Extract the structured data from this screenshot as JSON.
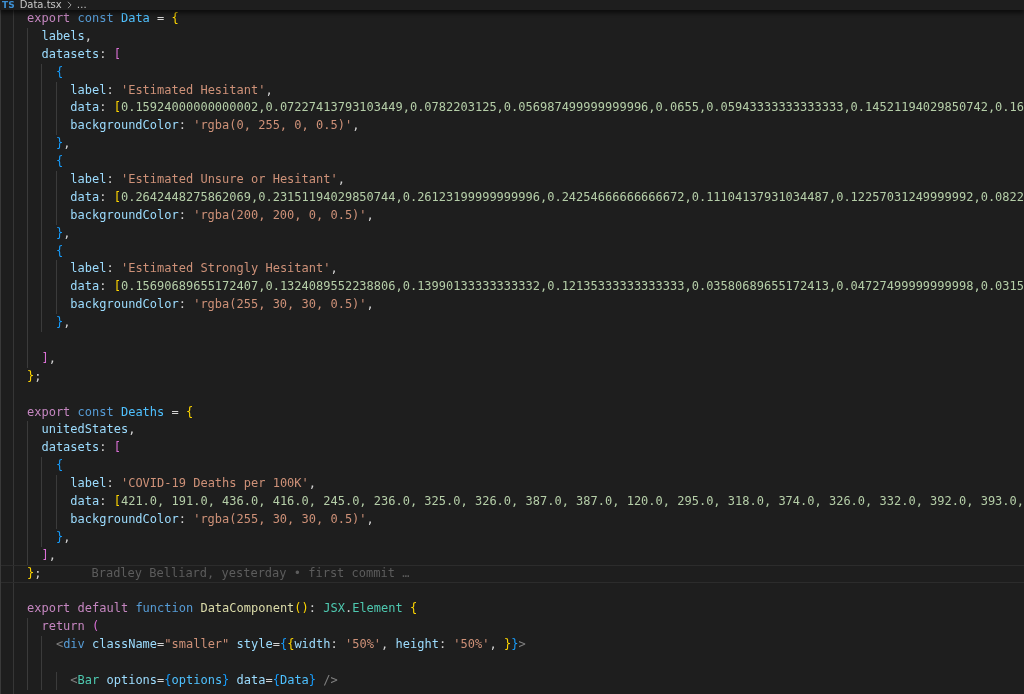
{
  "breadcrumb": {
    "file_icon": "TS",
    "items": [
      "Data.tsx",
      "…"
    ]
  },
  "editor": {
    "lines": [
      {
        "tokens": [
          {
            "kind": "keyword",
            "text": "export "
          },
          {
            "kind": "storage",
            "text": "const "
          },
          {
            "kind": "constant",
            "text": "Data"
          },
          {
            "kind": "plain",
            "text": " = "
          },
          {
            "kind": "bracket1",
            "text": "{"
          }
        ]
      },
      {
        "tokens": [
          {
            "kind": "property",
            "text": "  labels"
          },
          {
            "kind": "plain",
            "text": ","
          }
        ]
      },
      {
        "tokens": [
          {
            "kind": "property",
            "text": "  datasets"
          },
          {
            "kind": "plain",
            "text": ": "
          },
          {
            "kind": "bracket2",
            "text": "["
          }
        ]
      },
      {
        "tokens": [
          {
            "kind": "bracket3",
            "text": "    {"
          }
        ]
      },
      {
        "tokens": [
          {
            "kind": "property",
            "text": "      label"
          },
          {
            "kind": "plain",
            "text": ": "
          },
          {
            "kind": "string",
            "text": "'Estimated Hesitant'"
          },
          {
            "kind": "plain",
            "text": ","
          }
        ]
      },
      {
        "tokens": [
          {
            "kind": "property",
            "text": "      data"
          },
          {
            "kind": "plain",
            "text": ": "
          },
          {
            "kind": "bracket1",
            "text": "["
          },
          {
            "kind": "number",
            "text": "0.15924000000000002,0.07227413793103449,0.0782203125,0.056987499999999996,0.0655,0.05943333333333333,0.14521194029850742,0.16"
          }
        ]
      },
      {
        "tokens": [
          {
            "kind": "property",
            "text": "      backgroundColor"
          },
          {
            "kind": "plain",
            "text": ": "
          },
          {
            "kind": "string",
            "text": "'rgba(0, 255, 0, 0.5)'"
          },
          {
            "kind": "plain",
            "text": ","
          }
        ]
      },
      {
        "tokens": [
          {
            "kind": "bracket3",
            "text": "    }"
          },
          {
            "kind": "plain",
            "text": ","
          }
        ]
      },
      {
        "tokens": [
          {
            "kind": "bracket3",
            "text": "    {"
          }
        ]
      },
      {
        "tokens": [
          {
            "kind": "property",
            "text": "      label"
          },
          {
            "kind": "plain",
            "text": ": "
          },
          {
            "kind": "string",
            "text": "'Estimated Unsure or Hesitant'"
          },
          {
            "kind": "plain",
            "text": ","
          }
        ]
      },
      {
        "tokens": [
          {
            "kind": "property",
            "text": "      data"
          },
          {
            "kind": "plain",
            "text": ": "
          },
          {
            "kind": "bracket1",
            "text": "["
          },
          {
            "kind": "number",
            "text": "0.2642448275862069,0.23151194029850744,0.26123199999999996,0.24254666666666672,0.11104137931034487,0.12257031249999992,0.0822"
          }
        ]
      },
      {
        "tokens": [
          {
            "kind": "property",
            "text": "      backgroundColor"
          },
          {
            "kind": "plain",
            "text": ": "
          },
          {
            "kind": "string",
            "text": "'rgba(200, 200, 0, 0.5)'"
          },
          {
            "kind": "plain",
            "text": ","
          }
        ]
      },
      {
        "tokens": [
          {
            "kind": "bracket3",
            "text": "    }"
          },
          {
            "kind": "plain",
            "text": ","
          }
        ]
      },
      {
        "tokens": [
          {
            "kind": "bracket3",
            "text": "    {"
          }
        ]
      },
      {
        "tokens": [
          {
            "kind": "property",
            "text": "      label"
          },
          {
            "kind": "plain",
            "text": ": "
          },
          {
            "kind": "string",
            "text": "'Estimated Strongly Hesitant'"
          },
          {
            "kind": "plain",
            "text": ","
          }
        ]
      },
      {
        "tokens": [
          {
            "kind": "property",
            "text": "      data"
          },
          {
            "kind": "plain",
            "text": ": "
          },
          {
            "kind": "bracket1",
            "text": "["
          },
          {
            "kind": "number",
            "text": "0.15690689655172407,0.1324089552238806,0.13990133333333332,0.12135333333333333,0.03580689655172413,0.04727499999999998,0.0315"
          }
        ]
      },
      {
        "tokens": [
          {
            "kind": "property",
            "text": "      backgroundColor"
          },
          {
            "kind": "plain",
            "text": ": "
          },
          {
            "kind": "string",
            "text": "'rgba(255, 30, 30, 0.5)'"
          },
          {
            "kind": "plain",
            "text": ","
          }
        ]
      },
      {
        "tokens": [
          {
            "kind": "bracket3",
            "text": "    }"
          },
          {
            "kind": "plain",
            "text": ","
          }
        ]
      },
      {
        "kind": "blank"
      },
      {
        "tokens": [
          {
            "kind": "bracket2",
            "text": "  ]"
          },
          {
            "kind": "plain",
            "text": ","
          }
        ]
      },
      {
        "tokens": [
          {
            "kind": "bracket1",
            "text": "}"
          },
          {
            "kind": "plain",
            "text": ";"
          }
        ]
      },
      {
        "kind": "blank"
      },
      {
        "tokens": [
          {
            "kind": "keyword",
            "text": "export "
          },
          {
            "kind": "storage",
            "text": "const "
          },
          {
            "kind": "constant",
            "text": "Deaths"
          },
          {
            "kind": "plain",
            "text": " = "
          },
          {
            "kind": "bracket1",
            "text": "{"
          }
        ]
      },
      {
        "tokens": [
          {
            "kind": "property",
            "text": "  unitedStates"
          },
          {
            "kind": "plain",
            "text": ","
          }
        ]
      },
      {
        "tokens": [
          {
            "kind": "property",
            "text": "  datasets"
          },
          {
            "kind": "plain",
            "text": ": "
          },
          {
            "kind": "bracket2",
            "text": "["
          }
        ]
      },
      {
        "tokens": [
          {
            "kind": "bracket3",
            "text": "    {"
          }
        ]
      },
      {
        "tokens": [
          {
            "kind": "property",
            "text": "      label"
          },
          {
            "kind": "plain",
            "text": ": "
          },
          {
            "kind": "string",
            "text": "'COVID-19 Deaths per 100K'"
          },
          {
            "kind": "plain",
            "text": ","
          }
        ]
      },
      {
        "tokens": [
          {
            "kind": "property",
            "text": "      data"
          },
          {
            "kind": "plain",
            "text": ": "
          },
          {
            "kind": "bracket1",
            "text": "["
          },
          {
            "kind": "number",
            "text": "421.0, 191.0, 436.0, 416.0, 245.0, 236.0, 325.0, 326.0, 387.0, 387.0, 120.0, 295.0, 318.0, 374.0, 326.0, 332.0, 392.0, 393.0,"
          }
        ]
      },
      {
        "tokens": [
          {
            "kind": "property",
            "text": "      backgroundColor"
          },
          {
            "kind": "plain",
            "text": ": "
          },
          {
            "kind": "string",
            "text": "'rgba(255, 30, 30, 0.5)'"
          },
          {
            "kind": "plain",
            "text": ","
          }
        ]
      },
      {
        "tokens": [
          {
            "kind": "bracket3",
            "text": "    }"
          },
          {
            "kind": "plain",
            "text": ","
          }
        ]
      },
      {
        "tokens": [
          {
            "kind": "bracket2",
            "text": "  ]"
          },
          {
            "kind": "plain",
            "text": ","
          }
        ]
      },
      {
        "tokens": [
          {
            "kind": "bracket1",
            "text": "}"
          },
          {
            "kind": "plain",
            "text": ";"
          }
        ],
        "current": true,
        "blame": "Bradley Belliard, yesterday • first commit …"
      },
      {
        "kind": "blank"
      },
      {
        "tokens": [
          {
            "kind": "keyword",
            "text": "export default "
          },
          {
            "kind": "storage",
            "text": "function "
          },
          {
            "kind": "function",
            "text": "DataComponent"
          },
          {
            "kind": "bracket1",
            "text": "()"
          },
          {
            "kind": "plain",
            "text": ": "
          },
          {
            "kind": "type",
            "text": "JSX"
          },
          {
            "kind": "plain",
            "text": "."
          },
          {
            "kind": "type",
            "text": "Element "
          },
          {
            "kind": "bracket1",
            "text": "{"
          }
        ]
      },
      {
        "tokens": [
          {
            "kind": "keyword",
            "text": "  return "
          },
          {
            "kind": "bracket2",
            "text": "("
          }
        ]
      },
      {
        "tokens": [
          {
            "kind": "tag",
            "text": "    <"
          },
          {
            "kind": "storage",
            "text": "div "
          },
          {
            "kind": "property",
            "text": "className"
          },
          {
            "kind": "plain",
            "text": "="
          },
          {
            "kind": "string",
            "text": "\"smaller\" "
          },
          {
            "kind": "property",
            "text": "style"
          },
          {
            "kind": "plain",
            "text": "="
          },
          {
            "kind": "bracket3",
            "text": "{"
          },
          {
            "kind": "bracket1",
            "text": "{"
          },
          {
            "kind": "property",
            "text": "width"
          },
          {
            "kind": "plain",
            "text": ": "
          },
          {
            "kind": "string",
            "text": "'50%'"
          },
          {
            "kind": "plain",
            "text": ", "
          },
          {
            "kind": "property",
            "text": "height"
          },
          {
            "kind": "plain",
            "text": ": "
          },
          {
            "kind": "string",
            "text": "'50%'"
          },
          {
            "kind": "plain",
            "text": ", "
          },
          {
            "kind": "bracket1",
            "text": "}"
          },
          {
            "kind": "bracket3",
            "text": "}"
          },
          {
            "kind": "tag",
            "text": ">"
          }
        ]
      },
      {
        "kind": "blank"
      },
      {
        "tokens": [
          {
            "kind": "tag",
            "text": "      <"
          },
          {
            "kind": "type",
            "text": "Bar "
          },
          {
            "kind": "property",
            "text": "options"
          },
          {
            "kind": "plain",
            "text": "="
          },
          {
            "kind": "bracket3",
            "text": "{"
          },
          {
            "kind": "constant",
            "text": "options"
          },
          {
            "kind": "bracket3",
            "text": "} "
          },
          {
            "kind": "property",
            "text": "data"
          },
          {
            "kind": "plain",
            "text": "="
          },
          {
            "kind": "bracket3",
            "text": "{"
          },
          {
            "kind": "constant",
            "text": "Data"
          },
          {
            "kind": "bracket3",
            "text": "} "
          },
          {
            "kind": "tag",
            "text": "/>"
          }
        ]
      }
    ]
  }
}
